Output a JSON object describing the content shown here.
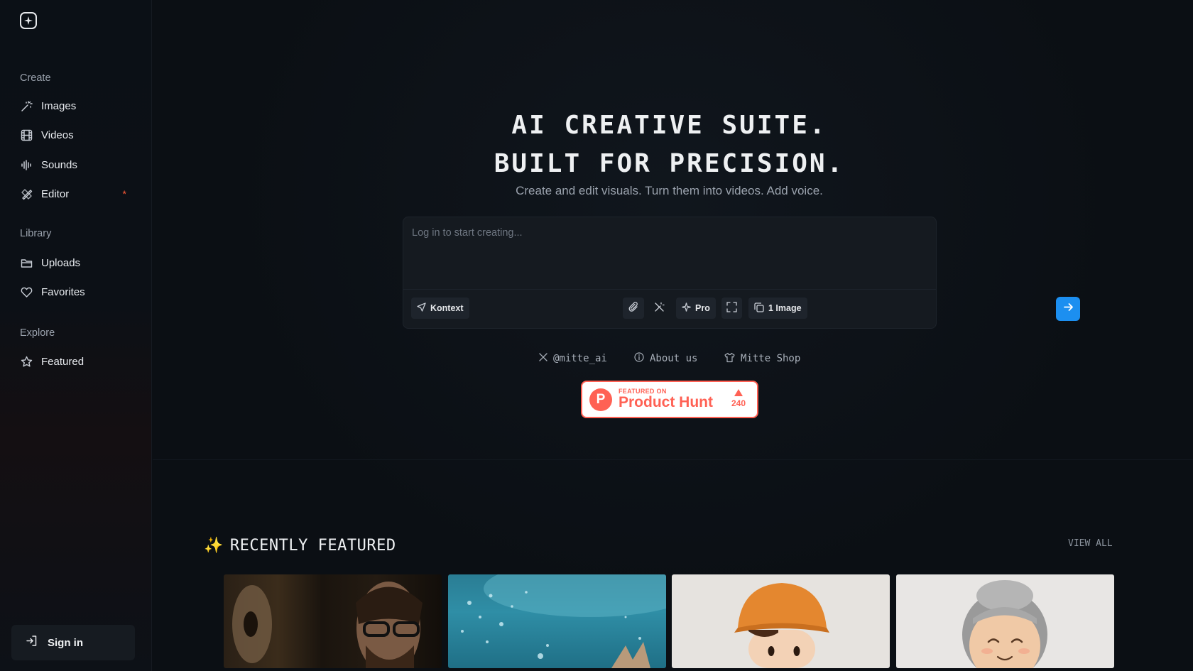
{
  "sidebar": {
    "sections": {
      "create": "Create",
      "library": "Library",
      "explore": "Explore"
    },
    "items": [
      {
        "label": "Images",
        "icon": "magic-wand-icon"
      },
      {
        "label": "Videos",
        "icon": "film-icon"
      },
      {
        "label": "Sounds",
        "icon": "audio-waveform-icon"
      },
      {
        "label": "Editor",
        "icon": "pen-ruler-icon",
        "badge": "*"
      },
      {
        "label": "Uploads",
        "icon": "folder-icon"
      },
      {
        "label": "Favorites",
        "icon": "heart-icon"
      },
      {
        "label": "Featured",
        "icon": "star-icon"
      }
    ],
    "sign_in": "Sign in"
  },
  "hero": {
    "title_line1": "AI CREATIVE SUITE.",
    "title_line2": "BUILT FOR PRECISION.",
    "subtitle": "Create and edit visuals. Turn them into videos. Add voice."
  },
  "prompt": {
    "placeholder": "Log in to start creating...",
    "model_label": "Kontext",
    "pro_label": "Pro",
    "count_label": "1 Image"
  },
  "links": {
    "twitter": "@mitte_ai",
    "about": "About us",
    "shop": "Mitte Shop"
  },
  "product_hunt": {
    "featured_on": "FEATURED ON",
    "name": "Product Hunt",
    "logo_letter": "P",
    "votes": "240"
  },
  "featured": {
    "title": "RECENTLY FEATURED",
    "emoji": "✨",
    "view_all": "VIEW ALL"
  },
  "colors": {
    "accent": "#1c8ff0",
    "product_hunt": "#ff6154",
    "badge_dot": "#ff5a36"
  }
}
